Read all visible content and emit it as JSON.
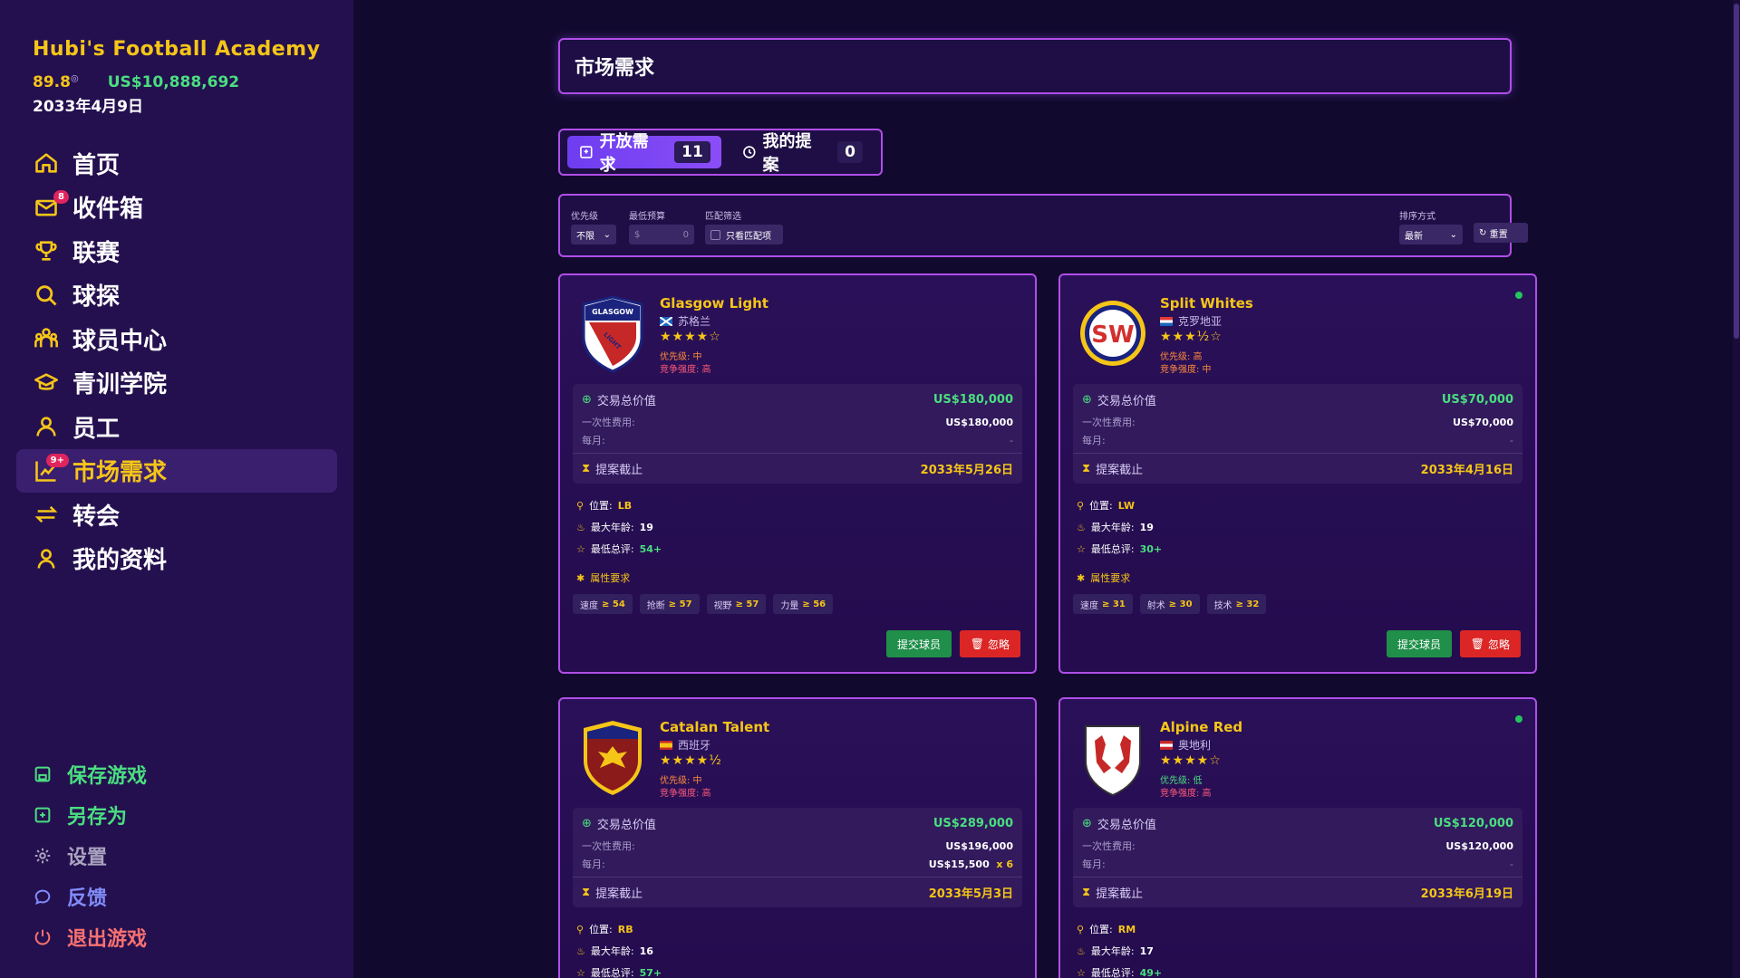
{
  "brand": {
    "title": "Hubi's Football Academy",
    "rating": "89.8",
    "rating_mark": "◎",
    "money": "US$10,888,692",
    "date": "2033年4月9日"
  },
  "nav": [
    {
      "label": "首页",
      "icon": "home-icon"
    },
    {
      "label": "收件箱",
      "icon": "mail-icon",
      "badge": "8"
    },
    {
      "label": "联赛",
      "icon": "trophy-icon"
    },
    {
      "label": "球探",
      "icon": "search-icon"
    },
    {
      "label": "球员中心",
      "icon": "players-icon"
    },
    {
      "label": "青训学院",
      "icon": "graduation-cap-icon"
    },
    {
      "label": "员工",
      "icon": "staff-icon"
    },
    {
      "label": "市场需求",
      "icon": "chart-icon",
      "badge": "9+",
      "active": true
    },
    {
      "label": "转会",
      "icon": "transfer-icon"
    },
    {
      "label": "我的资料",
      "icon": "profile-icon"
    }
  ],
  "system": {
    "save": "保存游戏",
    "save_as": "另存为",
    "settings": "设置",
    "feedback": "反馈",
    "quit": "退出游戏"
  },
  "colors": {
    "accent": "#f5c518",
    "success": "#4ade80",
    "border": "#b04ee8",
    "danger": "#dc2626"
  },
  "page": {
    "title": "市场需求"
  },
  "tabs": {
    "open_label": "开放需求",
    "open_count": "11",
    "mine_label": "我的提案",
    "mine_count": "0"
  },
  "filters": {
    "priority_label": "优先级",
    "priority_value": "不限",
    "budget_label": "最低预算",
    "budget_prefix": "$",
    "budget_placeholder": "0",
    "match_label": "匹配筛选",
    "match_checkbox": "只看匹配项",
    "sort_label": "排序方式",
    "sort_value": "最新",
    "reset": "重置"
  },
  "card_labels": {
    "deal_total": "交易总价值",
    "one_time": "一次性费用:",
    "monthly": "每月:",
    "deadline": "提案截止",
    "position": "位置:",
    "max_age": "最大年龄:",
    "min_rating": "最低总评:",
    "attr_title": "属性要求",
    "submit": "提交球员",
    "ignore": "忽略"
  },
  "cards": [
    {
      "name": "Glasgow Light",
      "country": "苏格兰",
      "stars": "★★★★☆",
      "priority": "优先级: 中",
      "competition": "竞争强度: 高",
      "total": "US$180,000",
      "one_time": "US$180,000",
      "monthly": "-",
      "deadline": "2033年5月26日",
      "position": "LB",
      "max_age": "19",
      "min_rating": "54+",
      "attrs": [
        {
          "k": "速度",
          "v": "≥ 54"
        },
        {
          "k": "抢断",
          "v": "≥ 57"
        },
        {
          "k": "视野",
          "v": "≥ 57"
        },
        {
          "k": "力量",
          "v": "≥ 56"
        }
      ],
      "crest_text": "GLASGOW",
      "crest_text2": "LIGHT"
    },
    {
      "name": "Split Whites",
      "country": "克罗地亚",
      "stars": "★★★½☆",
      "priority": "优先级: 高",
      "competition": "竞争强度: 中",
      "total": "US$70,000",
      "one_time": "US$70,000",
      "monthly": "-",
      "deadline": "2033年4月16日",
      "position": "LW",
      "max_age": "19",
      "min_rating": "30+",
      "attrs": [
        {
          "k": "速度",
          "v": "≥ 31"
        },
        {
          "k": "射术",
          "v": "≥ 30"
        },
        {
          "k": "技术",
          "v": "≥ 32"
        }
      ],
      "crest_text": "SW"
    },
    {
      "name": "Catalan Talent",
      "country": "西班牙",
      "stars": "★★★★½",
      "priority": "优先级: 中",
      "competition": "竞争强度: 高",
      "total": "US$289,000",
      "one_time": "US$196,000",
      "monthly": "US$15,500",
      "monthly_mult": "x 6",
      "deadline": "2033年5月3日",
      "position": "RB",
      "max_age": "16",
      "min_rating": "57+",
      "attrs": []
    },
    {
      "name": "Alpine Red",
      "country": "奥地利",
      "stars": "★★★★☆",
      "priority": "优先级: 低",
      "competition": "竞争强度: 高",
      "total": "US$120,000",
      "one_time": "US$120,000",
      "monthly": "-",
      "deadline": "2033年6月19日",
      "position": "RM",
      "max_age": "17",
      "min_rating": "49+",
      "attrs": []
    }
  ]
}
